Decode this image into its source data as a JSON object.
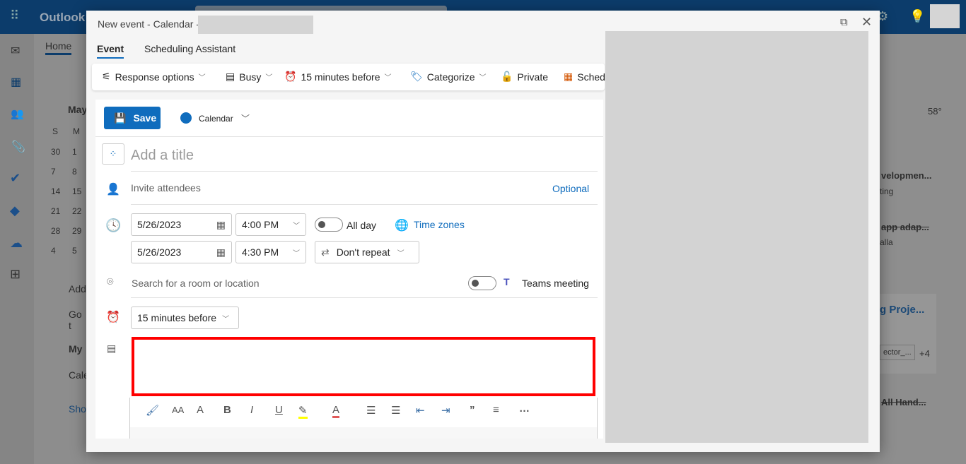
{
  "app": {
    "name": "Outlook",
    "ribbon_tab": "Home",
    "mini_month": "May",
    "weekdays": [
      "S",
      "M"
    ],
    "mini_days": [
      [
        "30",
        "1"
      ],
      [
        "7",
        "8"
      ],
      [
        "14",
        "15"
      ],
      [
        "21",
        "22"
      ],
      [
        "28",
        "29"
      ],
      [
        "4",
        "5"
      ]
    ],
    "side_links": [
      "Add",
      "Go t"
    ],
    "my_calendars": "My",
    "calendar_item": "Cale",
    "show": "Show",
    "weather": "58°"
  },
  "right_events": [
    "velopmen...",
    "ting",
    "app adap...",
    "alla",
    "g Proje...",
    "ector_...",
    "+4",
    "All Hand..."
  ],
  "dialog": {
    "title": "New event - Calendar -",
    "tabs": [
      "Event",
      "Scheduling Assistant"
    ],
    "toolbar": {
      "response": "Response options",
      "busy": "Busy",
      "reminder": "15 minutes before",
      "categorize": "Categorize",
      "private": "Private",
      "schedule": "Sched"
    },
    "save": "Save",
    "calendar": "Calendar",
    "calendar_color": "#0f6cbd",
    "title_placeholder": "Add a title",
    "attendees_placeholder": "Invite attendees",
    "optional": "Optional",
    "start_date": "5/26/2023",
    "start_time": "4:00 PM",
    "end_date": "5/26/2023",
    "end_time": "4:30 PM",
    "all_day": "All day",
    "time_zones": "Time zones",
    "repeat": "Don't repeat",
    "location_placeholder": "Search for a room or location",
    "teams": "Teams meeting",
    "reminder": "15 minutes before",
    "highlight_color": "#ff0000"
  }
}
